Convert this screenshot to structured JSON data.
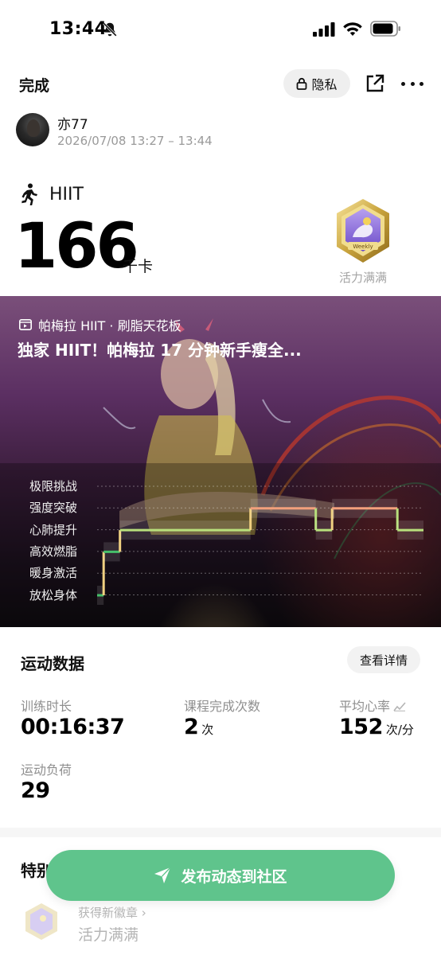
{
  "status_bar": {
    "time": "13:44"
  },
  "header": {
    "done_label": "完成",
    "privacy_label": "隐私"
  },
  "user": {
    "name": "亦77",
    "datetime": "2026/07/08 13:27 – 13:44"
  },
  "workout": {
    "type": "HIIT",
    "calories": "166",
    "calories_unit": "千卡",
    "badge_label": "活力满满",
    "badge_text": "Weekly"
  },
  "video": {
    "source": "帕梅拉 HIIT · 刷脂天花板",
    "title": "独家 HIIT！帕梅拉 17 分钟新手瘦全..."
  },
  "chart_data": {
    "type": "line",
    "title": "",
    "xlabel": "",
    "ylabel": "",
    "categories": [
      "极限挑战",
      "强度突破",
      "心肺提升",
      "高效燃脂",
      "暖身激活",
      "放松身体"
    ],
    "series": [
      {
        "values": [
          {
            "t": 0.0,
            "zone": "放松身体"
          },
          {
            "t": 0.02,
            "zone": "高效燃脂"
          },
          {
            "t": 0.07,
            "zone": "心肺提升"
          },
          {
            "t": 0.47,
            "zone": "强度突破"
          },
          {
            "t": 0.67,
            "zone": "心肺提升"
          },
          {
            "t": 0.72,
            "zone": "强度突破"
          },
          {
            "t": 0.92,
            "zone": "心肺提升"
          },
          {
            "t": 1.0,
            "zone": "心肺提升"
          }
        ]
      }
    ],
    "grid": true,
    "colors": [
      "#46c06a",
      "#b8e07c",
      "#f0d080",
      "#f3a07c"
    ]
  },
  "data_section": {
    "title": "运动数据",
    "detail_button": "查看详情",
    "duration_label": "训练时长",
    "duration_value": "00:16:37",
    "completions_label": "课程完成次数",
    "completions_value": "2",
    "completions_unit": "次",
    "hr_label": "平均心率",
    "hr_value": "152",
    "hr_unit": "次/分",
    "load_label": "运动负荷",
    "load_value": "29"
  },
  "special": {
    "title": "特别",
    "new_badge_label": "获得新徽章 ›",
    "new_badge_name": "活力满满"
  },
  "publish_button": "发布动态到社区"
}
